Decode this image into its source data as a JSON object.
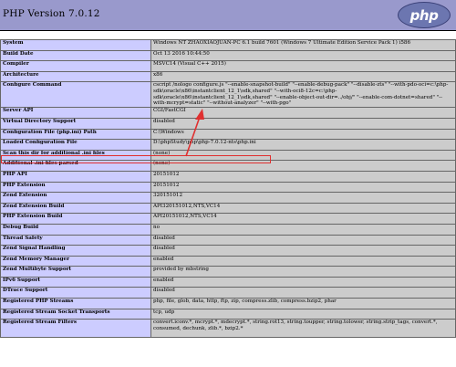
{
  "header": {
    "title": "PHP Version 7.0.12",
    "logo_text": "php"
  },
  "rows": [
    {
      "label": "System",
      "value": "Windows NT ZHAOXIAOJUAN-PC 6.1 build 7601 (Windows 7 Ultimate Edition Service Pack 1) i586"
    },
    {
      "label": "Build Date",
      "value": "Oct 13 2016 10:44:50"
    },
    {
      "label": "Compiler",
      "value": "MSVC14 (Visual C++ 2015)"
    },
    {
      "label": "Architecture",
      "value": "x86"
    },
    {
      "label": "Configure Command",
      "value": "cscript /nologo configure.js \"--enable-snapshot-build\" \"--enable-debug-pack\" \"--disable-zts\" \"--with-pdo-oci=c:\\php-sdk\\oracle\\x86\\instantclient_12_1\\sdk,shared\" \"--with-oci8-12c=c:\\php-sdk\\oracle\\x86\\instantclient_12_1\\sdk,shared\" \"--enable-object-out-dir=../obj/\" \"--enable-com-dotnet=shared\" \"--with-mcrypt=static\" \"--without-analyzer\" \"--with-pgo\""
    },
    {
      "label": "Server API",
      "value": "CGI/FastCGI"
    },
    {
      "label": "Virtual Directory Support",
      "value": "disabled"
    },
    {
      "label": "Configuration File (php.ini) Path",
      "value": "C:\\Windows"
    },
    {
      "label": "Loaded Configuration File",
      "value": "D:\\phpStudy\\php\\php-7.0.12-nts\\php.ini"
    },
    {
      "label": "Scan this dir for additional .ini files",
      "value": "(none)"
    },
    {
      "label": "Additional .ini files parsed",
      "value": "(none)"
    },
    {
      "label": "PHP API",
      "value": "20151012"
    },
    {
      "label": "PHP Extension",
      "value": "20151012"
    },
    {
      "label": "Zend Extension",
      "value": "320151012"
    },
    {
      "label": "Zend Extension Build",
      "value": "API320151012,NTS,VC14"
    },
    {
      "label": "PHP Extension Build",
      "value": "API20151012,NTS,VC14"
    },
    {
      "label": "Debug Build",
      "value": "no"
    },
    {
      "label": "Thread Safety",
      "value": "disabled"
    },
    {
      "label": "Zend Signal Handling",
      "value": "disabled"
    },
    {
      "label": "Zend Memory Manager",
      "value": "enabled"
    },
    {
      "label": "Zend Multibyte Support",
      "value": "provided by mbstring"
    },
    {
      "label": "IPv6 Support",
      "value": "enabled"
    },
    {
      "label": "DTrace Support",
      "value": "disabled"
    },
    {
      "label": "Registered PHP Streams",
      "value": "php, file, glob, data, http, ftp, zip, compress.zlib, compress.bzip2, phar"
    },
    {
      "label": "Registered Stream Socket Transports",
      "value": "tcp, udp"
    },
    {
      "label": "Registered Stream Filters",
      "value": "convert.iconv.*, mcrypt.*, mdecrypt.*, string.rot13, string.toupper, string.tolower, string.strip_tags, convert.*, consumed, dechunk, zlib.*, bzip2.*"
    }
  ],
  "colors": {
    "header_bg": "#9999cc",
    "label_bg": "#ccccff",
    "value_bg": "#cccccc",
    "annotation": "#e03030"
  },
  "icons": {
    "logo": "php-logo",
    "annotation": "arrow-annotation"
  }
}
